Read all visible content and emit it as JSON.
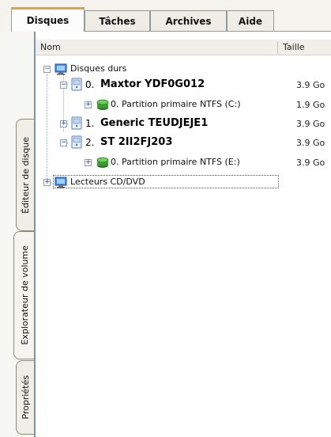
{
  "tabs": [
    "Disques",
    "Tâches",
    "Archives",
    "Aide"
  ],
  "side_tabs": [
    "Éditeur de disque",
    "Explorateur de volume",
    "Propriétés"
  ],
  "columns": {
    "name": "Nom",
    "size": "Taille"
  },
  "tree": {
    "root1": "Disques durs",
    "disks": [
      {
        "index": "0.",
        "name": "Maxtor YDF0G012",
        "size": "3.9 Go",
        "partition": {
          "label": "0. Partition primaire NTFS (C:)",
          "size": "1.9 Go"
        }
      },
      {
        "index": "1.",
        "name": "Generic TEUDJEJE1",
        "size": "3.9 Go"
      },
      {
        "index": "2.",
        "name": "ST 2II2FJ203",
        "size": "3.9 Go",
        "partition": {
          "label": "0. Partition primaire NTFS (E:)",
          "size": "3.9 Go"
        }
      }
    ],
    "root2": "Lecteurs CD/DVD"
  },
  "colors": {
    "active_tab_accent": "#e8a23a",
    "selection_dotted": "#555555"
  }
}
